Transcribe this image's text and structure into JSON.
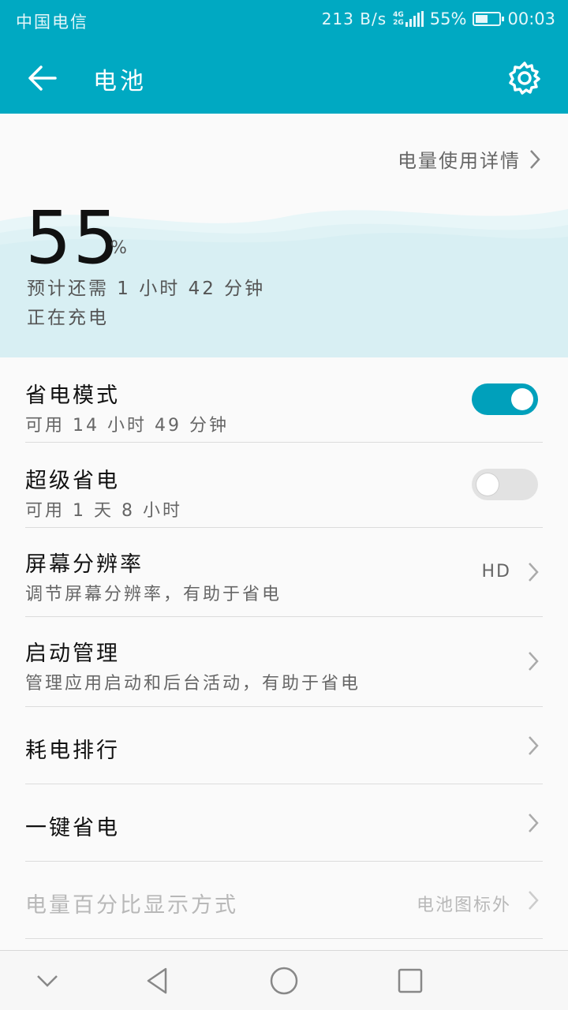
{
  "status_bar": {
    "carrier": "中国电信",
    "net_speed": "213 B/s",
    "network_tag_top": "4G",
    "network_tag_bottom": "2G",
    "battery_pct": "55%",
    "time": "00:03",
    "battery_level": 0.55
  },
  "app_bar": {
    "title": "电池",
    "back_icon": "arrow-left-icon",
    "settings_icon": "gear-icon"
  },
  "header": {
    "details_link": "电量使用详情",
    "battery_value": "55",
    "battery_unit": "%",
    "remaining": "预计还需 1 小时 42 分钟",
    "charging_status": "正在充电"
  },
  "settings": [
    {
      "title": "省电模式",
      "subtitle": "可用 14 小时 49 分钟",
      "control": "toggle",
      "on": true
    },
    {
      "title": "超级省电",
      "subtitle": "可用 1 天 8 小时",
      "control": "toggle",
      "on": false
    },
    {
      "title": "屏幕分辨率",
      "subtitle": "调节屏幕分辨率，有助于省电",
      "value": "HD",
      "control": "chevron"
    },
    {
      "title": "启动管理",
      "subtitle": "管理应用启动和后台活动，有助于省电",
      "control": "chevron"
    },
    {
      "title": "耗电排行",
      "control": "chevron"
    },
    {
      "title": "一键省电",
      "control": "chevron"
    },
    {
      "title": "电量百分比显示方式",
      "value": "电池图标外",
      "control": "chevron",
      "disabled": true
    }
  ],
  "colors": {
    "accent": "#00a9c2",
    "toggle_on": "#00a0bb",
    "wave_light": "#d8f0f4"
  },
  "nav_bar": {
    "icons": [
      "chevron-down-icon",
      "back-triangle-icon",
      "home-circle-icon",
      "recents-square-icon"
    ]
  }
}
